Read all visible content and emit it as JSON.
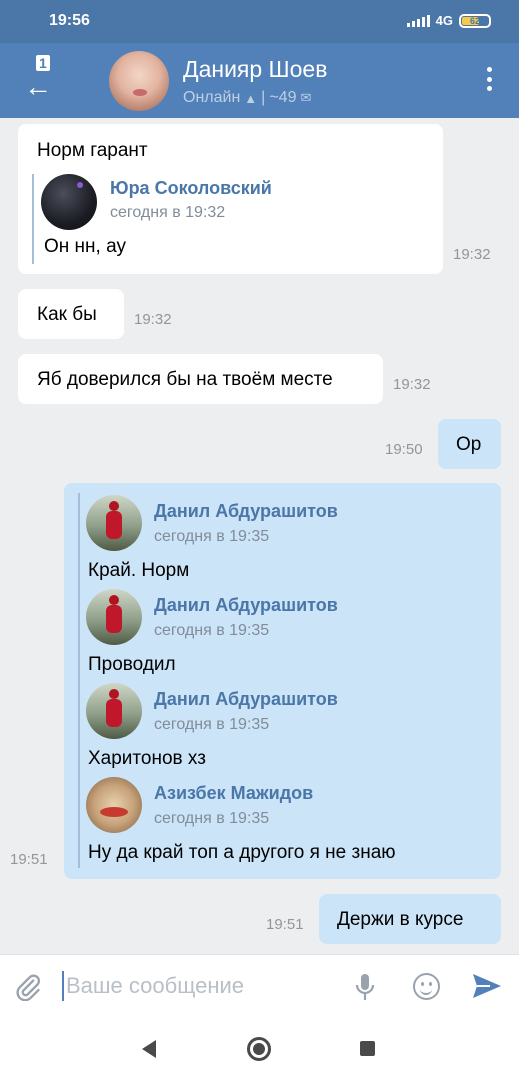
{
  "status_bar": {
    "time": "19:56",
    "network": "4G",
    "battery": "62"
  },
  "header": {
    "back_count": "1",
    "name": "Данияр Шоев",
    "status": "Онлайн",
    "status_extra": "~49"
  },
  "messages": [
    {
      "direction": "in",
      "text": "Норм гарант",
      "time": "19:32",
      "forwarded": [
        {
          "name": "Юра Соколовский",
          "date": "сегодня в 19:32",
          "text": "Он нн, ау",
          "avatar": "dark-avatar"
        }
      ]
    },
    {
      "direction": "in",
      "text": "Как бы",
      "time": "19:32"
    },
    {
      "direction": "in",
      "text": "Яб доверился бы на твоём месте",
      "time": "19:32"
    },
    {
      "direction": "out",
      "text": "Ор",
      "time": "19:50"
    },
    {
      "direction": "out",
      "time": "19:51",
      "forwarded": [
        {
          "name": "Данил Абдурашитов",
          "date": "сегодня в 19:35",
          "text": "Край. Норм",
          "avatar": "red-jacket-avatar"
        },
        {
          "name": "Данил Абдурашитов",
          "date": "сегодня в 19:35",
          "text": "Проводил",
          "avatar": "red-jacket-avatar"
        },
        {
          "name": "Данил Абдурашитов",
          "date": "сегодня в 19:35",
          "text": "Харитонов хз",
          "avatar": "red-jacket-avatar"
        },
        {
          "name": "Азизбек Мажидов",
          "date": "сегодня в 19:35",
          "text": "Ну да край топ а другого я не знаю",
          "avatar": "cartoon-avatar"
        }
      ]
    },
    {
      "direction": "out",
      "text": "Держи в курсе",
      "time": "19:51"
    }
  ],
  "composer": {
    "placeholder": "Ваше сообщение"
  },
  "colors": {
    "header": "#5181b8",
    "statusbar": "#4a76a8",
    "incoming": "#ffffff",
    "outgoing": "#cce4f7",
    "background": "#edeef0",
    "link": "#4a76a8"
  }
}
